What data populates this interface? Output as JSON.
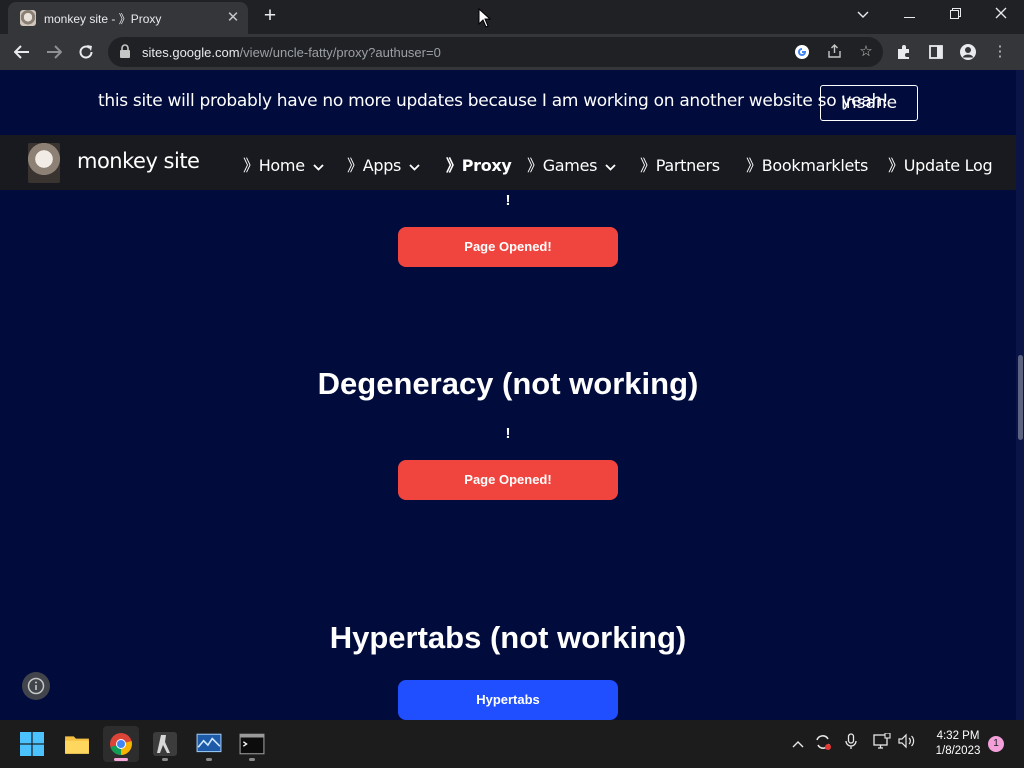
{
  "browser": {
    "tab_title": "monkey site - 》Proxy",
    "url_host": "sites.google.com",
    "url_path": "/view/uncle-fatty/proxy?authuser=0"
  },
  "banner": {
    "text": "this site will probably have no more updates because I am working on another website so yeah!",
    "button_label": "Insane"
  },
  "navbar": {
    "site_title": "monkey site",
    "items": [
      {
        "label": "》Home",
        "has_dropdown": true
      },
      {
        "label": "》Apps",
        "has_dropdown": true
      },
      {
        "label": "》Proxy",
        "has_dropdown": false,
        "active": true
      },
      {
        "label": "》Games",
        "has_dropdown": true
      },
      {
        "label": "》Partners",
        "has_dropdown": false
      },
      {
        "label": "》Bookmarklets",
        "has_dropdown": false
      },
      {
        "label": "》Update Log",
        "has_dropdown": false
      }
    ]
  },
  "content": {
    "top_excl": "!",
    "top_button": "Page Opened!",
    "section2_title": "Degeneracy (not working)",
    "section2_excl": "!",
    "section2_button": "Page Opened!",
    "section3_title": "Hypertabs (not working)",
    "section3_button": "Hypertabs"
  },
  "taskbar": {
    "time": "4:32 PM",
    "date": "1/8/2023",
    "notification_count": "1"
  },
  "colors": {
    "page_bg": "#010b3c",
    "nav_bg": "#191a1f",
    "red_button": "#f0453f",
    "blue_button": "#1f4fff"
  }
}
